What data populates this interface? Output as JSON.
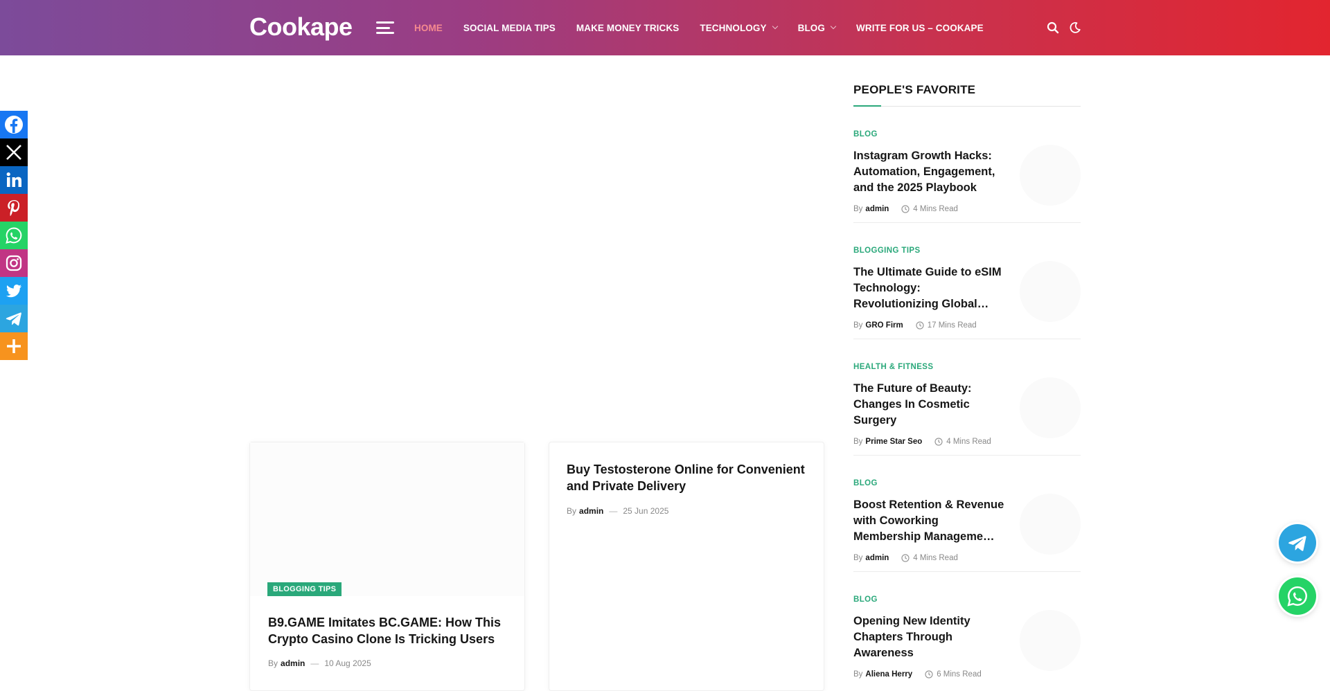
{
  "header": {
    "logo": "Cookape",
    "nav": [
      {
        "label": "HOME",
        "active": true,
        "dropdown": false
      },
      {
        "label": "SOCIAL MEDIA TIPS",
        "active": false,
        "dropdown": false
      },
      {
        "label": "MAKE MONEY TRICKS",
        "active": false,
        "dropdown": false
      },
      {
        "label": "TECHNOLOGY",
        "active": false,
        "dropdown": true
      },
      {
        "label": "BLOG",
        "active": false,
        "dropdown": true
      },
      {
        "label": "WRITE FOR US – COOKAPE",
        "active": false,
        "dropdown": false
      }
    ],
    "icons": [
      "search-icon",
      "dark-mode-icon"
    ],
    "gradient": [
      "#7c4b9a",
      "#e2252f"
    ]
  },
  "social_share": [
    {
      "name": "facebook",
      "color": "#1877f2"
    },
    {
      "name": "x",
      "color": "#000000"
    },
    {
      "name": "linkedin",
      "color": "#0a66c2"
    },
    {
      "name": "pinterest",
      "color": "#cb2027"
    },
    {
      "name": "whatsapp",
      "color": "#25d366"
    },
    {
      "name": "instagram",
      "color": "#c13584"
    },
    {
      "name": "twitter",
      "color": "#1da1f2"
    },
    {
      "name": "telegram",
      "color": "#2ca5e0"
    },
    {
      "name": "more",
      "color": "#f7931e"
    }
  ],
  "main": {
    "cards": [
      {
        "category": "BLOGGING TIPS",
        "title": "B9.GAME Imitates BC.GAME: How This Crypto Casino Clone Is Tricking Users",
        "by": "By",
        "author": "admin",
        "date": "10 Aug 2025"
      },
      {
        "title": "Buy Testosterone Online for Convenient and Private Delivery",
        "by": "By",
        "author": "admin",
        "date": "25 Jun 2025"
      }
    ]
  },
  "sidebar": {
    "title": "PEOPLE'S FAVORITE",
    "posts": [
      {
        "category": "BLOG",
        "title": "Instagram Growth Hacks: Automation, Engagement, and the 2025 Playbook",
        "by": "By",
        "author": "admin",
        "read": "4 Mins Read"
      },
      {
        "category": "BLOGGING TIPS",
        "title": "The Ultimate Guide to eSIM Technology: Revolutionizing Global…",
        "by": "By",
        "author": "GRO Firm",
        "read": "17 Mins Read"
      },
      {
        "category": "HEALTH & FITNESS",
        "title": "The Future of Beauty: Changes In Cosmetic Surgery",
        "by": "By",
        "author": "Prime Star Seo",
        "read": "4 Mins Read"
      },
      {
        "category": "BLOG",
        "title": "Boost Retention & Revenue with Coworking Membership Manageme…",
        "by": "By",
        "author": "admin",
        "read": "4 Mins Read"
      },
      {
        "category": "BLOG",
        "title": "Opening New Identity Chapters Through Awareness",
        "by": "By",
        "author": "Aliena Herry",
        "read": "6 Mins Read"
      }
    ]
  },
  "floating": [
    {
      "name": "telegram",
      "color": "#2ca5e0"
    },
    {
      "name": "whatsapp",
      "color": "#25d366"
    }
  ],
  "colors": {
    "accent": "#2aa87a",
    "active_nav": "#f58a8f"
  }
}
